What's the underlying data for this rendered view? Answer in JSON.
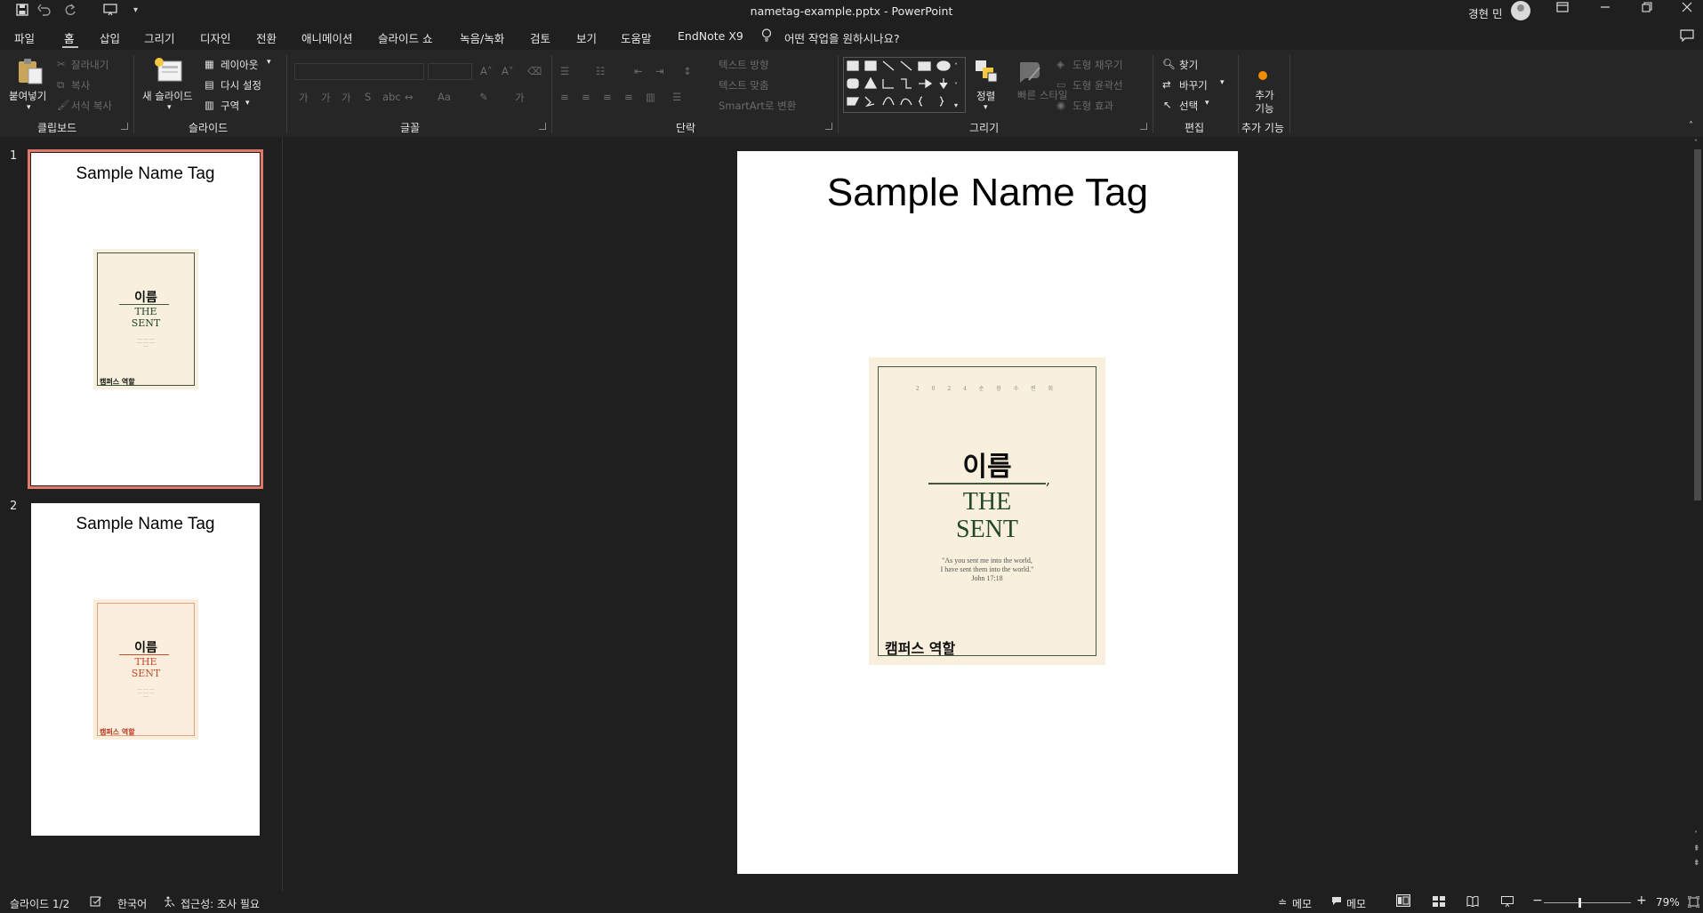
{
  "window": {
    "title": "nametag-example.pptx  -  PowerPoint",
    "user": "경현 민"
  },
  "menu": {
    "tabs": [
      "파일",
      "홈",
      "삽입",
      "그리기",
      "디자인",
      "전환",
      "애니메이션",
      "슬라이드 쇼",
      "녹음/녹화",
      "검토",
      "보기",
      "도움말",
      "EndNote X9"
    ],
    "active_tab": "홈",
    "search_placeholder": "어떤 작업을 원하시나요?"
  },
  "ribbon": {
    "clipboard": {
      "paste": "붙여넣기",
      "cut": "잘라내기",
      "copy": "복사",
      "format_painter": "서식 복사",
      "label": "클립보드"
    },
    "slides": {
      "new_slide": "새 슬라이드",
      "layout": "레이아웃",
      "reset": "다시 설정",
      "section": "구역",
      "label": "슬라이드"
    },
    "font": {
      "label": "글꼴",
      "aa": "Aa"
    },
    "paragraph": {
      "text_direction": "텍스트 방향",
      "align_text": "텍스트 맞춤",
      "smartart": "SmartArt로 변환",
      "label": "단락"
    },
    "drawing": {
      "arrange": "정렬",
      "quick_styles": "빠른 스타일",
      "shape_fill": "도형 채우기",
      "shape_outline": "도형 윤곽선",
      "shape_effects": "도형 효과",
      "label": "그리기"
    },
    "editing": {
      "find": "찾기",
      "replace": "바꾸기",
      "select": "선택",
      "label": "편집"
    },
    "addins": {
      "addins": "추가 기능",
      "label": "추가 기능"
    }
  },
  "slides": [
    {
      "number": "1",
      "title": "Sample Name Tag",
      "name": "이름",
      "line1": "THE",
      "line2": "SENT",
      "role": "캠퍼스 역할",
      "theme": "#23472d"
    },
    {
      "number": "2",
      "title": "Sample Name Tag",
      "name": "이름",
      "line1": "THE",
      "line2": "SENT",
      "role": "캠퍼스 역할",
      "theme": "#c44a2e"
    }
  ],
  "current_slide": {
    "title": "Sample Name Tag",
    "card": {
      "header": "2 0 2 4 순 장 수 련 회",
      "name": "이름",
      "comma": ",",
      "line1": "THE",
      "line2": "SENT",
      "quote1": "\"As you sent me into the world,",
      "quote2": "I have sent them into the world.\"",
      "quote3": "John 17:18",
      "role": "캠퍼스 역할"
    }
  },
  "status": {
    "slide_indicator": "슬라이드 1/2",
    "language": "한국어",
    "accessibility": "접근성: 조사 필요",
    "notes": "메모",
    "comments": "메모",
    "zoom": "79%",
    "zoom_level": 0.79
  },
  "colors": {
    "accent_selection": "#e2786a",
    "card_bg": "#f8f0dc",
    "card_green": "#23472d",
    "addins_dot": "#f28b00"
  }
}
